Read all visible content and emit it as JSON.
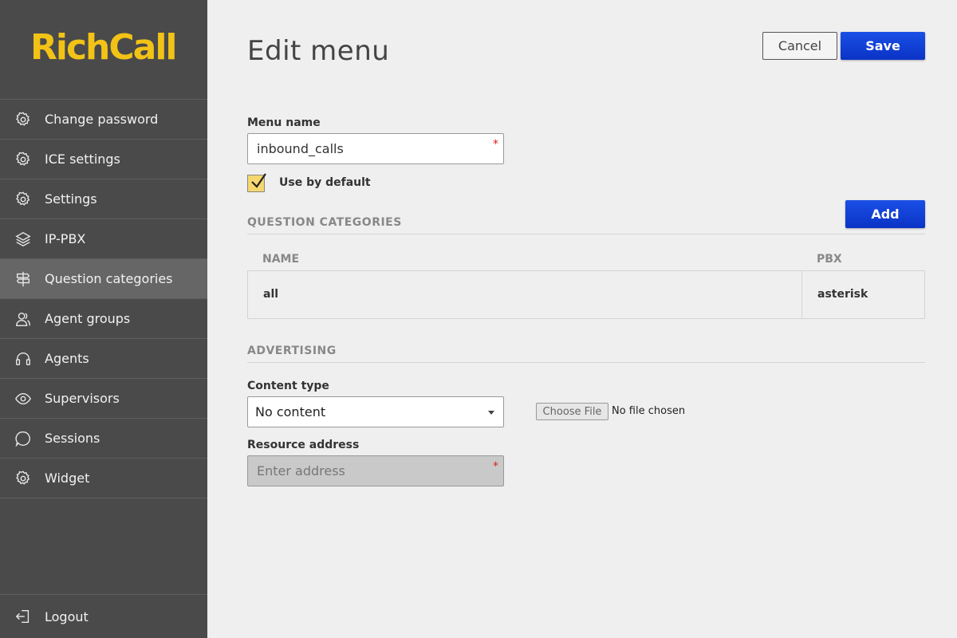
{
  "sidebar": {
    "logo": "RichCall",
    "items": [
      {
        "label": "Change password",
        "icon": "gear-icon",
        "active": false
      },
      {
        "label": "ICE settings",
        "icon": "gear-icon",
        "active": false
      },
      {
        "label": "Settings",
        "icon": "gear-icon",
        "active": false
      },
      {
        "label": "IP-PBX",
        "icon": "layers-icon",
        "active": false
      },
      {
        "label": "Question categories",
        "icon": "signpost-icon",
        "active": true
      },
      {
        "label": "Agent groups",
        "icon": "user-group-icon",
        "active": false
      },
      {
        "label": "Agents",
        "icon": "headset-icon",
        "active": false
      },
      {
        "label": "Supervisors",
        "icon": "eye-icon",
        "active": false
      },
      {
        "label": "Sessions",
        "icon": "chat-icon",
        "active": false
      },
      {
        "label": "Widget",
        "icon": "gear-icon",
        "active": false
      }
    ],
    "logout": "Logout"
  },
  "header": {
    "title": "Edit menu",
    "cancel_label": "Cancel",
    "save_label": "Save"
  },
  "form": {
    "menu_name_label": "Menu name",
    "menu_name_value": "inbound_calls",
    "required_mark": "*",
    "use_by_default_label": "Use by default",
    "use_by_default_checked": true
  },
  "question_categories": {
    "title": "QUESTION CATEGORIES",
    "add_label": "Add",
    "columns": [
      "NAME",
      "PBX"
    ],
    "rows": [
      [
        "all",
        "asterisk"
      ]
    ]
  },
  "advertising": {
    "title": "ADVERTISING",
    "content_type_label": "Content type",
    "content_type_value": "No content",
    "choose_file_label": "Choose File",
    "file_status": "No file chosen",
    "resource_address_label": "Resource address",
    "resource_address_placeholder": "Enter address"
  },
  "colors": {
    "sidebar_bg": "#4a4a4a",
    "sidebar_active": "#666666",
    "logo": "#f2c316",
    "primary": "#1a4fe6",
    "page_bg": "#efefef",
    "required": "#e02020"
  }
}
